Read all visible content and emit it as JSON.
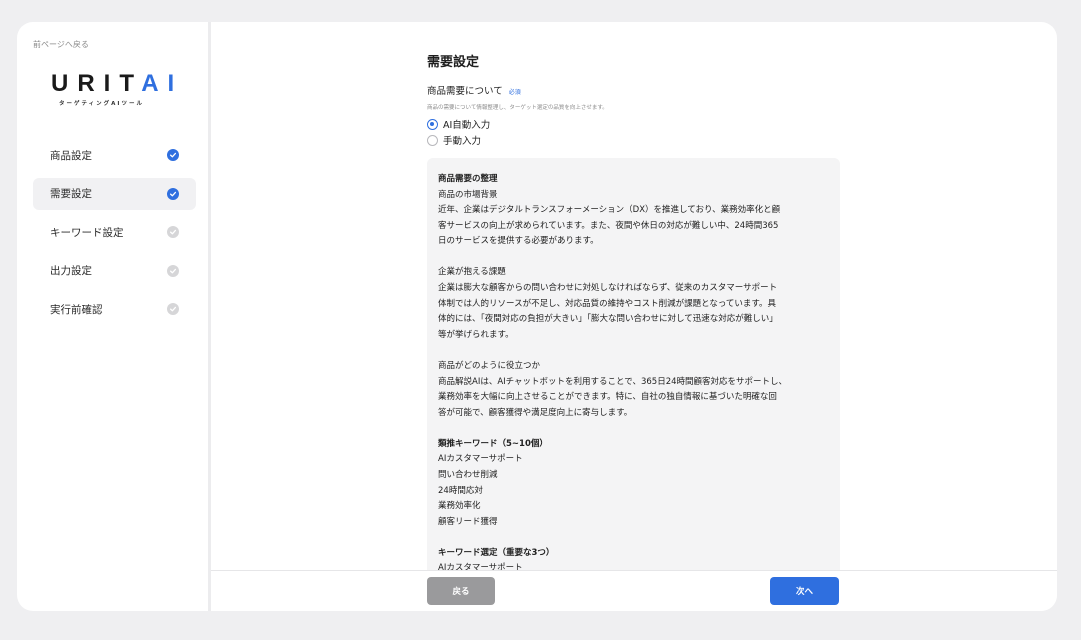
{
  "sidebar": {
    "back_link": "前ページへ戻る",
    "logo_main_prefix": "URIT",
    "logo_main_ai": "AI",
    "logo_sub": "ターゲティングAIツール",
    "steps": [
      {
        "label": "商品設定",
        "status": "done"
      },
      {
        "label": "需要設定",
        "status": "done",
        "active": true
      },
      {
        "label": "キーワード設定",
        "status": "todo"
      },
      {
        "label": "出力設定",
        "status": "todo"
      },
      {
        "label": "実行前確認",
        "status": "todo"
      }
    ]
  },
  "main": {
    "title": "需要設定",
    "section_label": "商品需要について",
    "required_badge": "必須",
    "section_desc": "商品の需要について情報整理し、ターゲット選定の品質を向上させます。",
    "options": [
      {
        "label": "AI自動入力",
        "checked": true
      },
      {
        "label": "手動入力",
        "checked": false
      }
    ],
    "content": {
      "b1_heading": "商品需要の整理",
      "b1_sub": "商品の市場背景",
      "b1_body": "近年、企業はデジタルトランスフォーメーション（DX）を推進しており、業務効率化と顧\n客サービスの向上が求められています。また、夜間や休日の対応が難しい中、24時間365\n日のサービスを提供する必要があります。",
      "b2_sub": "企業が抱える課題",
      "b2_body": "企業は膨大な顧客からの問い合わせに対処しなければならず、従来のカスタマーサポート\n体制では人的リソースが不足し、対応品質の維持やコスト削減が課題となっています。具\n体的には、「夜間対応の負担が大きい」「膨大な問い合わせに対して迅速な対応が難しい」\n等が挙げられます。",
      "b3_sub": "商品がどのように役立つか",
      "b3_body": "商品解説AIは、AIチャットボットを利用することで、365日24時間顧客対応をサポートし、\n業務効率を大幅に向上させることができます。特に、自社の独自情報に基づいた明確な回\n答が可能で、顧客獲得や満足度向上に寄与します。",
      "b4_heading": "類推キーワード（5~10個）",
      "b4_items": "AIカスタマーサポート\n問い合わせ削減\n24時間応対\n業務効率化\n顧客リード獲得",
      "b5_heading": "キーワード選定（重要な3つ）",
      "b5_items": "AIカスタマーサポート"
    }
  },
  "footer": {
    "back_label": "戻る",
    "next_label": "次へ"
  },
  "colors": {
    "accent": "#2f6fdf",
    "pending": "#d6d6d8",
    "back_button": "#9a9a9c"
  }
}
